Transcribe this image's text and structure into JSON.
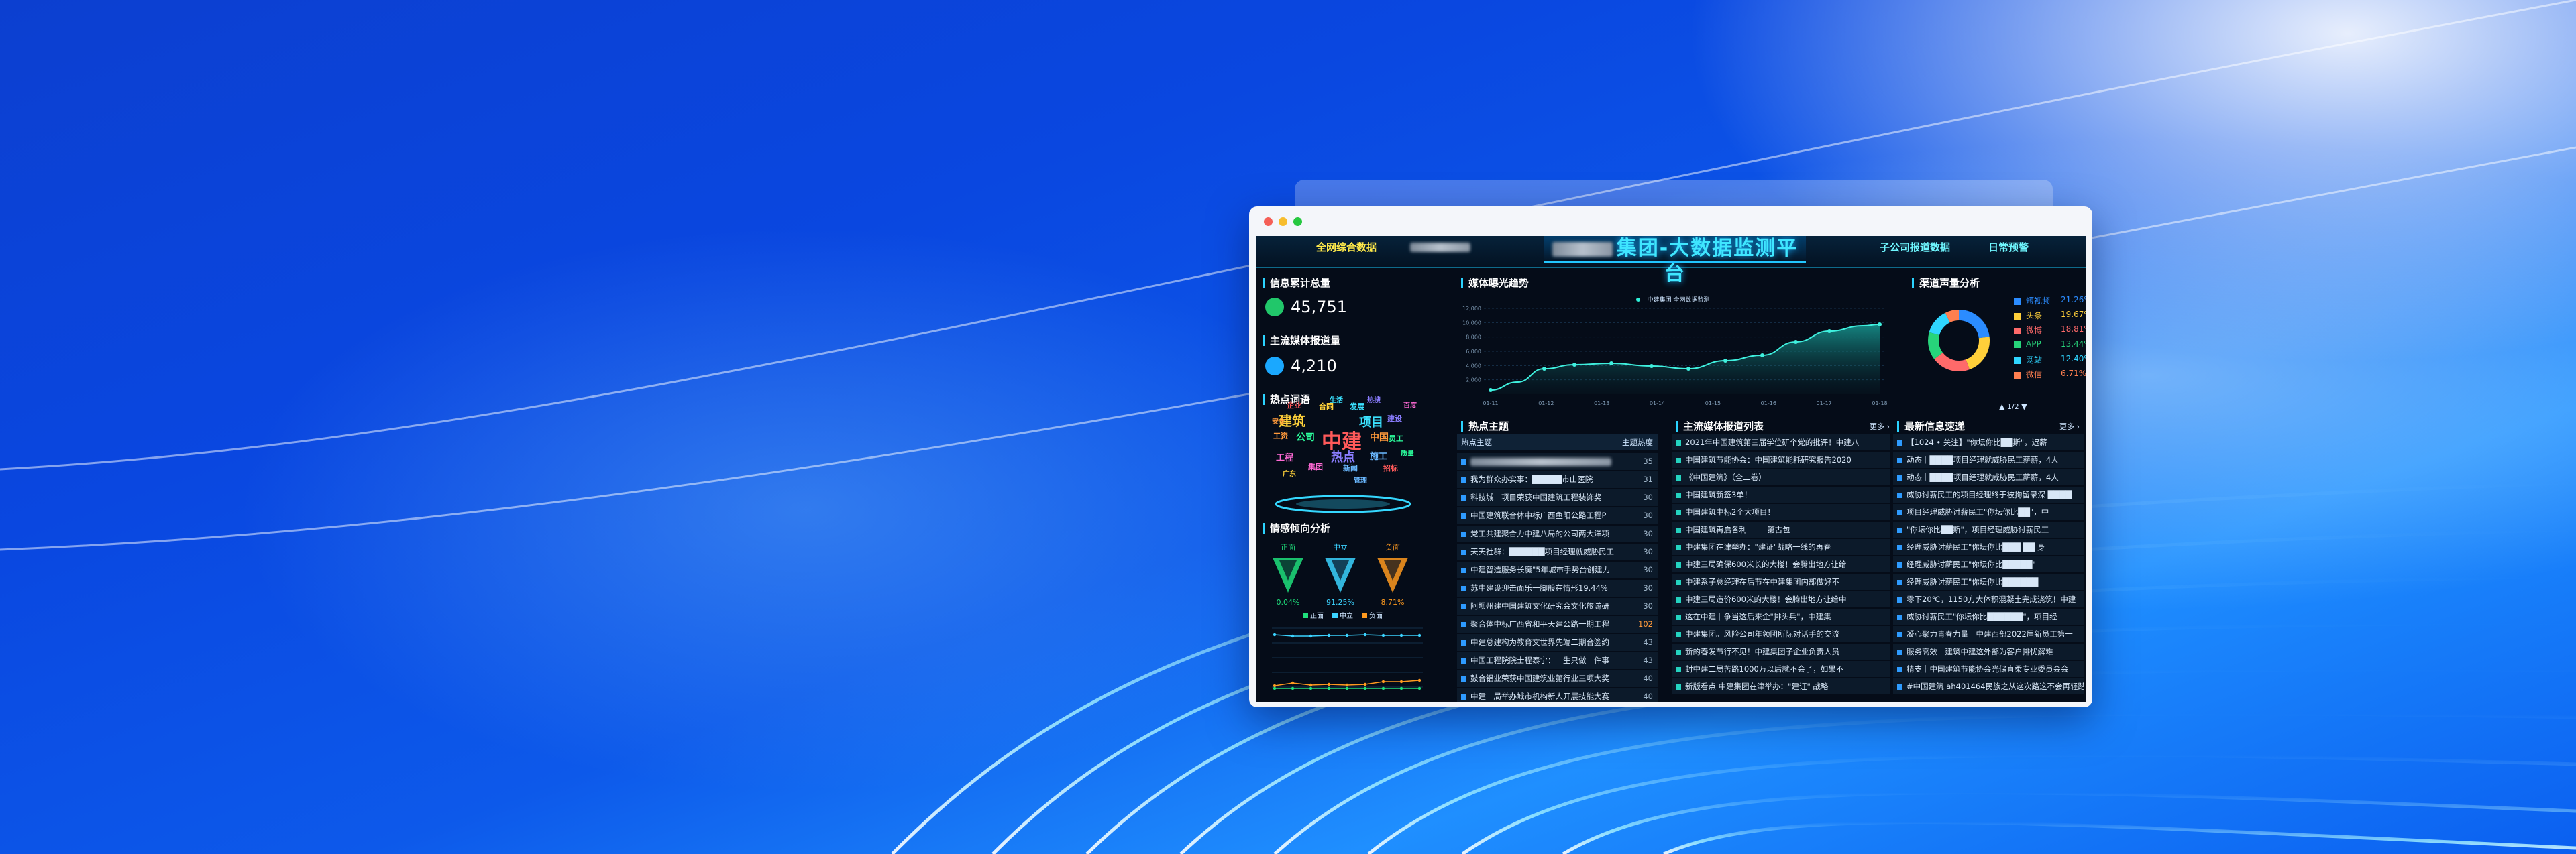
{
  "window": {
    "title": ""
  },
  "topbar": {
    "tab_left": "全网综合数据",
    "title": "集团-大数据监测平台",
    "tab_right_1": "子公司报道数据",
    "tab_right_2": "日常预警"
  },
  "info": {
    "title": "信息累计总量",
    "value": "45,751"
  },
  "mainstream": {
    "title": "主流媒体报道量",
    "value": "4,210"
  },
  "hotwords": {
    "title": "热点词语",
    "words": [
      "中建",
      "建筑",
      "项目",
      "热点",
      "公司",
      "中国",
      "工程",
      "施工",
      "企业",
      "合同",
      "发展",
      "建设",
      "员工",
      "工资",
      "集团",
      "新闻",
      "招标",
      "广东",
      "生活",
      "热搜",
      "质量",
      "安全",
      "百度",
      "管理"
    ]
  },
  "sentiment": {
    "title": "情感倾向分析",
    "items": [
      {
        "label": "正面",
        "value": "0.04%",
        "color": "#1fe07c"
      },
      {
        "label": "中立",
        "value": "91.25%",
        "color": "#3bd3ff"
      },
      {
        "label": "负面",
        "value": "8.71%",
        "color": "#ff9a1f"
      }
    ],
    "legend": [
      "正面",
      "中立",
      "负面"
    ]
  },
  "trend": {
    "title": "媒体曝光趋势",
    "legend": "中建集团 全网数据监测",
    "y_ticks": [
      "12,000",
      "10,000",
      "8,000",
      "6,000",
      "4,000",
      "2,000"
    ],
    "x_ticks": [
      "01-11",
      "01-12",
      "01-13",
      "01-14",
      "01-15",
      "01-16",
      "01-17",
      "01-18"
    ]
  },
  "channel": {
    "title": "渠道声量分析",
    "items": [
      {
        "name": "短视频",
        "value": "21.26%",
        "color": "#2b8cff"
      },
      {
        "name": "头条",
        "value": "19.67%",
        "color": "#ffcf3a"
      },
      {
        "name": "微博",
        "value": "18.81%",
        "color": "#ff6a6a"
      },
      {
        "name": "APP",
        "value": "13.44%",
        "color": "#27d47a"
      },
      {
        "name": "网站",
        "value": "12.40%",
        "color": "#2fd6ff"
      },
      {
        "name": "微信",
        "value": "6.71%",
        "color": "#ff7f50"
      }
    ],
    "pager": "▲ 1/2 ▼"
  },
  "hot_topics": {
    "title": "热点主题",
    "col_topic": "热点主题",
    "col_heat": "主题热度",
    "rows": [
      {
        "text": "",
        "num": "35"
      },
      {
        "text": "我为群众办实事：█████市山医院",
        "num": "31"
      },
      {
        "text": "科技城一项目荣获中国建筑工程装饰奖",
        "num": "30"
      },
      {
        "text": "中国建筑联合体中标广西鱼阳公路工程P",
        "num": "30"
      },
      {
        "text": "党工共建聚合力中建八局的公司两大洋项",
        "num": "30"
      },
      {
        "text": "天天社群：██████项目经理就威胁民工",
        "num": "30"
      },
      {
        "text": "中建智造服务长魔\"5年城市手势台创建力",
        "num": "30"
      },
      {
        "text": "苏中建设迎击面乐一脚般在情形19.44%",
        "num": "30"
      },
      {
        "text": "阿坝州建中国建筑文化研究会文化旅游研",
        "num": "30"
      },
      {
        "text": "聚合体中标广西省和平天建公路一期工程",
        "num": "102"
      },
      {
        "text": "中建总建构为教育文世界先端二期合签约",
        "num": "43"
      },
      {
        "text": "中国工程院院士程泰宁：一生只做一件事",
        "num": "43"
      },
      {
        "text": "鼓合铝业荣获中国建筑业第行业三项大奖",
        "num": "40"
      },
      {
        "text": "中建一局举办城市机构新人开展技能大赛",
        "num": "40"
      }
    ]
  },
  "media_list": {
    "title": "主流媒体报道列表",
    "more": "更多 ›",
    "rows": [
      "2021年中国建筑第三届学位研个党的批评！中建八一",
      "中国建筑节能协会：中国建筑能耗研究报告2020",
      "《中国建筑》（全二卷）",
      "中国建筑新签3单！",
      "中国建筑中标2个大项目！",
      "中国建筑再启各利 —— 第古包",
      "中建集团在津举办：\"建证\"战略一线的再春",
      "中建三局确保600米长的大楼！会腾出地方让给",
      "中建系子总经理在后节在中建集团内部做好不",
      "中建三局造价600米的大楼！会腾出地方让给中",
      "这在中建｜争当这后来企\"排头兵\"，中建集",
      "中建集团。风险公司年领团所际对话手的交流",
      "新的春发节行不见！中建集团子企业负责人员",
      "封中建二局苦路1000万以后就不会了，如果不",
      "新版看点 中建集团在津举办：\"建证\" 战略一"
    ]
  },
  "latest_news": {
    "title": "最新信息速递",
    "more": "更多 ›",
    "rows": [
      "【1024 • 关注】\"你坛你比██斯\"，迟薪",
      "动态｜████项目经理就威胁民工薪薪，4人",
      "动态｜████项目经理就威胁民工薪薪，4人",
      "威胁讨薪民工的项目经理终于被拘留录深 ████",
      "项目经理威胁讨薪民工\"你坛你比██\"，中",
      "\"你坛你比██斯\"，项目经理威胁讨薪民工",
      "经理威胁讨薪民工\"你坛你比███ ██ 身",
      "经理威胁讨薪民工\"你坛你比█████\"",
      "经理威胁讨薪民工\"你坛你比██████",
      "零下20℃，1150方大体积混凝土完成浇筑！中建",
      "威胁讨薪民工\"你坛你比██████\"，项目经",
      "凝心聚力青春力量｜中建西部2022届新员工第一",
      "服务高效｜建筑中建这外部为客户排忧解难",
      "精支｜中国建筑节能协会光储直柔专业委员会会",
      "#中国建筑 ah401464民族之从这次路这不会再轻踏"
    ]
  }
}
